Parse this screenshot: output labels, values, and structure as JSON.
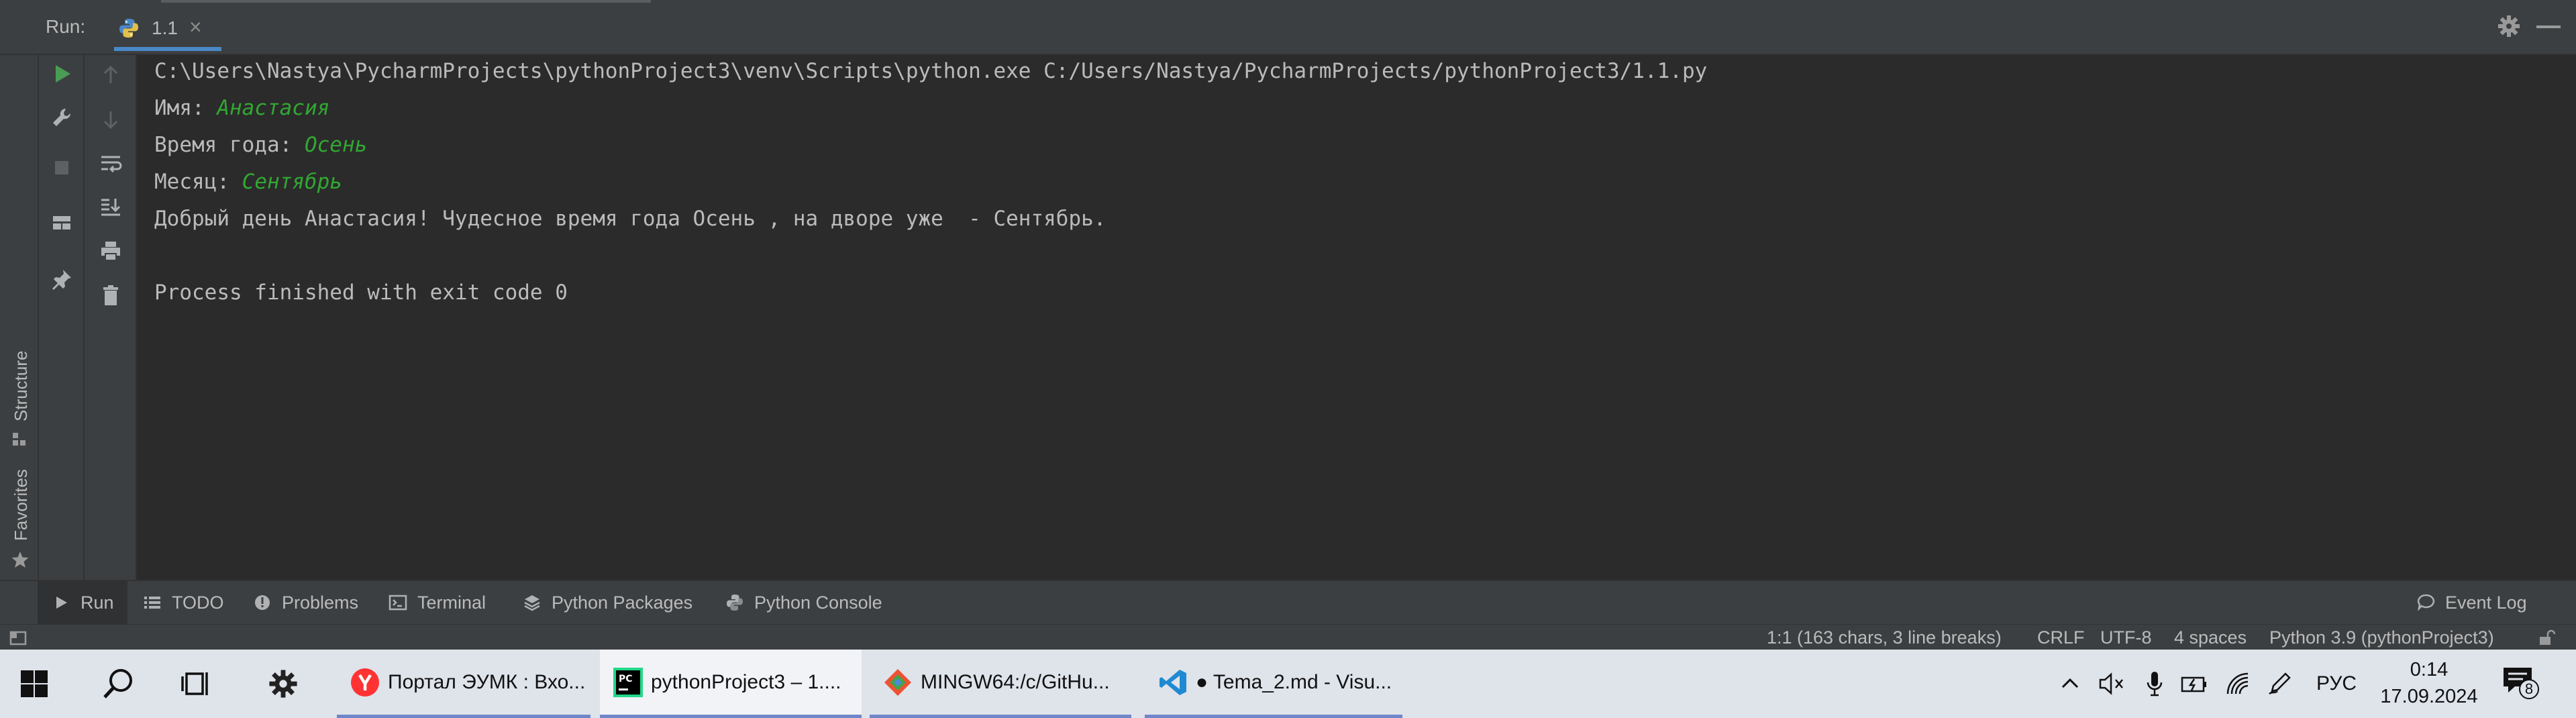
{
  "run_window": {
    "label": "Run:",
    "tab": {
      "name": "1.1",
      "icon": "python-file-icon",
      "close": "×"
    },
    "actions": {
      "settings_icon": "gear-icon",
      "minimize_icon": "minimize-icon"
    }
  },
  "left_stripe": {
    "structure_label": "Structure",
    "favorites_label": "Favorites"
  },
  "toolbar": {
    "column1": [
      "run-icon",
      "wrench-icon",
      "stop-icon",
      "layout-icon",
      "pin-icon"
    ],
    "column2": [
      "up-arrow-icon",
      "down-arrow-icon",
      "soft-wrap-icon",
      "scroll-to-end-icon",
      "print-icon",
      "trash-icon"
    ]
  },
  "console": {
    "command": "C:\\Users\\Nastya\\PycharmProjects\\pythonProject3\\venv\\Scripts\\python.exe C:/Users/Nastya/PycharmProjects/pythonProject3/1.1.py",
    "lines": [
      {
        "prompt": "Имя: ",
        "input": "Анастасия"
      },
      {
        "prompt": "Время года: ",
        "input": "Осень"
      },
      {
        "prompt": "Месяц: ",
        "input": "Сентябрь"
      }
    ],
    "output": "Добрый день Анастасия! Чудесное время года Осень , на дворе уже  - Сентябрь.",
    "exit": "Process finished with exit code 0"
  },
  "bottom_tools": {
    "run": "Run",
    "todo": "TODO",
    "problems": "Problems",
    "terminal": "Terminal",
    "python_packages": "Python Packages",
    "python_console": "Python Console",
    "event_log": "Event Log"
  },
  "status_bar": {
    "position": "1:1 (163 chars, 3 line breaks)",
    "line_sep": "CRLF",
    "encoding": "UTF-8",
    "indent": "4 spaces",
    "interpreter": "Python 3.9 (pythonProject3)"
  },
  "taskbar": {
    "apps": [
      {
        "label": "Портал ЭУМК : Вхо...",
        "icon": "yandex-browser-icon",
        "active": false
      },
      {
        "label": "pythonProject3 – 1....",
        "icon": "pycharm-icon",
        "active": true
      },
      {
        "label": "MINGW64:/c/GitHu...",
        "icon": "git-bash-icon",
        "active": false
      },
      {
        "label": "● Tema_2.md - Visu...",
        "icon": "vscode-icon",
        "active": false
      }
    ],
    "tray": {
      "language": "РУС",
      "time": "0:14",
      "date": "17.09.2024",
      "notifications_count": "8"
    }
  },
  "colors": {
    "ide_background": "#2b2b2b",
    "panel_background": "#3c3f41",
    "user_input": "#31a831",
    "accent": "#4a88c7",
    "taskbar": "#dfe3ea"
  }
}
